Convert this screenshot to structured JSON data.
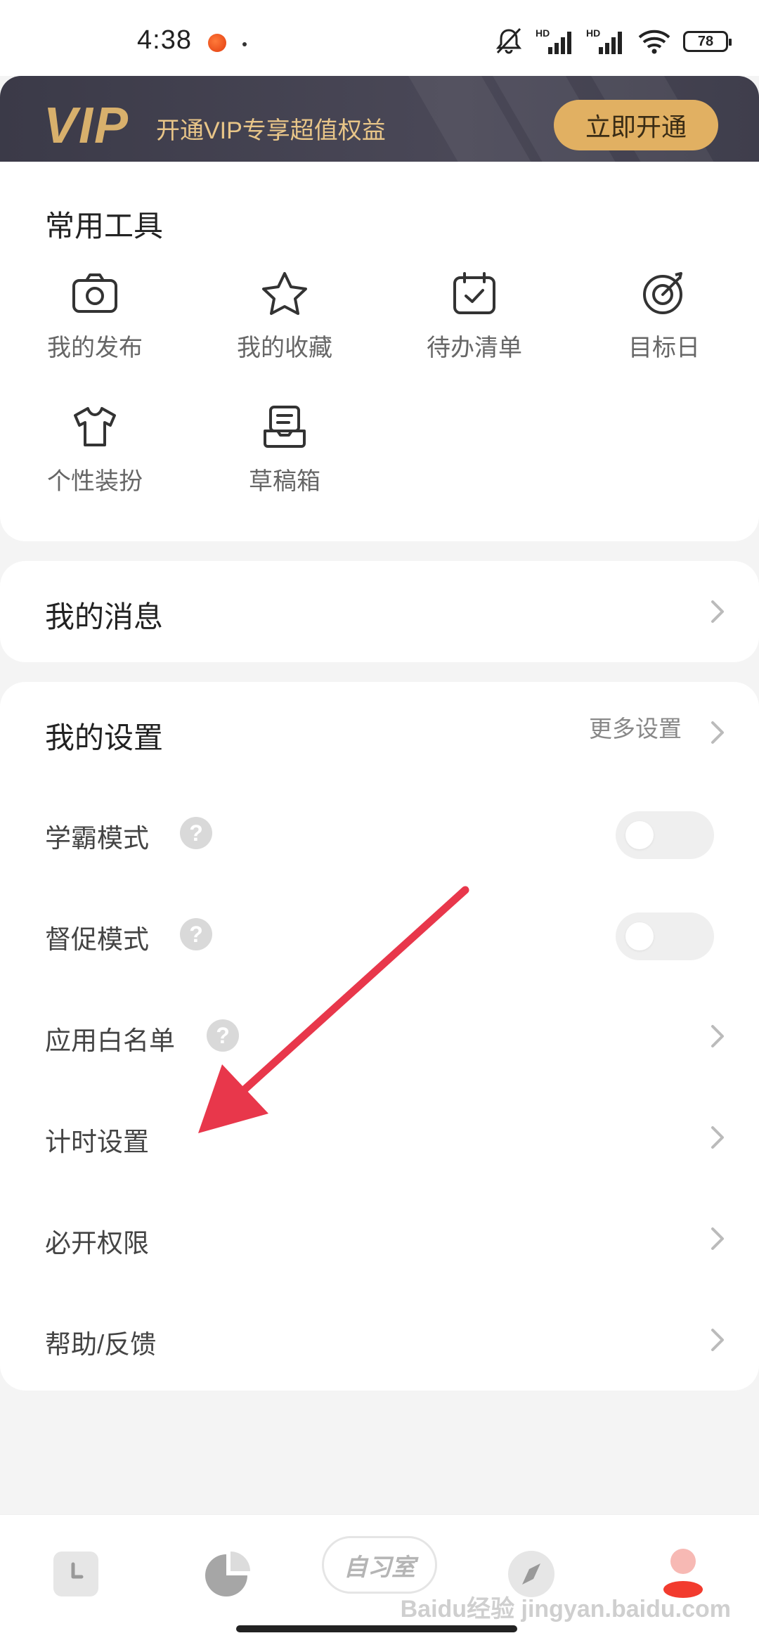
{
  "status_bar": {
    "time": "4:38",
    "battery": "78",
    "network_1": "HD",
    "network_2": "HD"
  },
  "vip": {
    "logo": "VIP",
    "slogan": "开通VIP专享超值权益",
    "button": "立即开通"
  },
  "tools": {
    "title": "常用工具",
    "items": [
      {
        "label": "我的发布",
        "icon": "camera-icon"
      },
      {
        "label": "我的收藏",
        "icon": "star-icon"
      },
      {
        "label": "待办清单",
        "icon": "calendar-check-icon"
      },
      {
        "label": "目标日",
        "icon": "target-icon"
      },
      {
        "label": "个性装扮",
        "icon": "shirt-icon"
      },
      {
        "label": "草稿箱",
        "icon": "draft-box-icon"
      }
    ]
  },
  "messages": {
    "title": "我的消息"
  },
  "settings": {
    "title": "我的设置",
    "more": "更多设置",
    "rows": [
      {
        "label": "学霸模式",
        "help": true,
        "control": "toggle",
        "on": false
      },
      {
        "label": "督促模式",
        "help": true,
        "control": "toggle",
        "on": false
      },
      {
        "label": "应用白名单",
        "help": true,
        "control": "chevron"
      },
      {
        "label": "计时设置",
        "help": false,
        "control": "chevron"
      },
      {
        "label": "必开权限",
        "help": false,
        "control": "chevron"
      },
      {
        "label": "帮助/反馈",
        "help": false,
        "control": "chevron"
      }
    ]
  },
  "bottom_nav": {
    "study_room": "自习室",
    "items": [
      "clock-icon",
      "pie-chart-icon",
      "study-room",
      "compass-icon",
      "profile-icon"
    ]
  },
  "colors": {
    "vip_gold": "#e1b062",
    "banner_dark": "#3b3a48",
    "annotation_arrow": "#e8374b"
  },
  "watermark": "Baidu经验 jingyan.baidu.com"
}
